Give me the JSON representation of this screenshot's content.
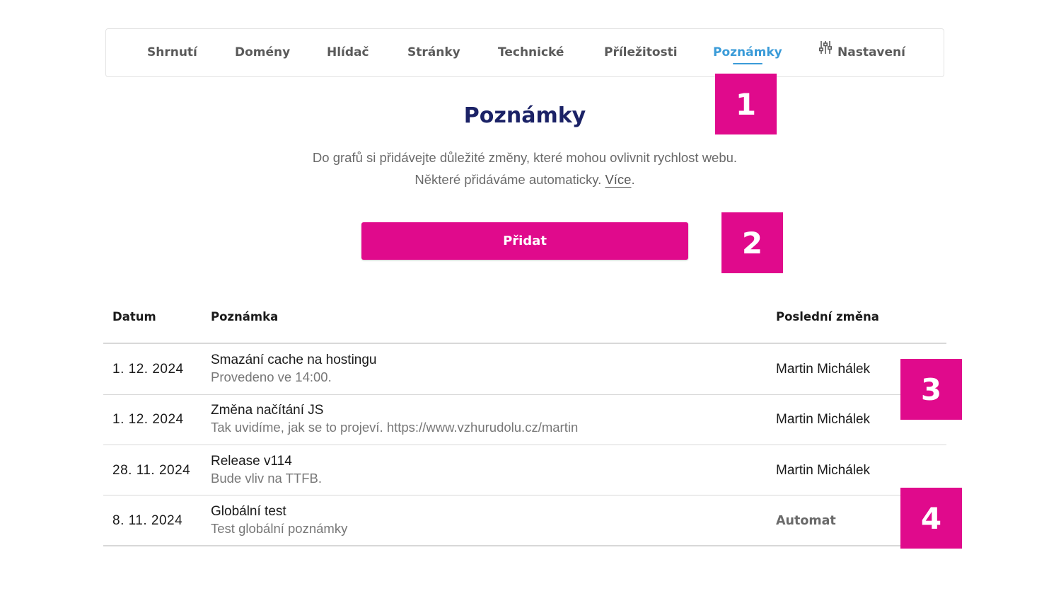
{
  "nav": {
    "tabs": [
      {
        "label": "Shrnutí"
      },
      {
        "label": "Domény"
      },
      {
        "label": "Hlídač"
      },
      {
        "label": "Stránky"
      },
      {
        "label": "Technické"
      },
      {
        "label": "Příležitosti"
      },
      {
        "label": "Poznámky",
        "active": true
      },
      {
        "label": "Nastavení",
        "icon": "sliders-icon"
      }
    ],
    "active_color": "#3a9bd8"
  },
  "page": {
    "title": "Poznámky",
    "description_line1": "Do grafů si přidávejte důležité změny, které mohou ovlivnit rychlost webu.",
    "description_line2": "Některé přidáváme automaticky.",
    "more_link": "Více",
    "more_suffix": "."
  },
  "add_button": {
    "label": "Přidat",
    "color": "#e00a8c"
  },
  "table": {
    "headers": {
      "date": "Datum",
      "note": "Poznámka",
      "changed_by": "Poslední změna"
    },
    "rows": [
      {
        "date": "1. 12. 2024",
        "title": "Smazání cache na hostingu",
        "subtitle": "Provedeno ve 14:00.",
        "author": "Martin Michálek"
      },
      {
        "date": "1. 12. 2024",
        "title": "Změna načítání JS",
        "subtitle": "Tak uvidíme, jak se to projeví. https://www.vzhurudolu.cz/martin",
        "author": "Martin Michálek"
      },
      {
        "date": "28. 11. 2024",
        "title": "Release v114",
        "subtitle": "Bude vliv na TTFB.",
        "author": "Martin Michálek"
      },
      {
        "date": "8. 11. 2024",
        "title": "Globální test",
        "subtitle": "Test globální poznámky",
        "author": "Automat"
      }
    ]
  },
  "annotations": {
    "badge1": "1",
    "badge2": "2",
    "badge3": "3",
    "badge4": "4",
    "color": "#e00a8c"
  }
}
